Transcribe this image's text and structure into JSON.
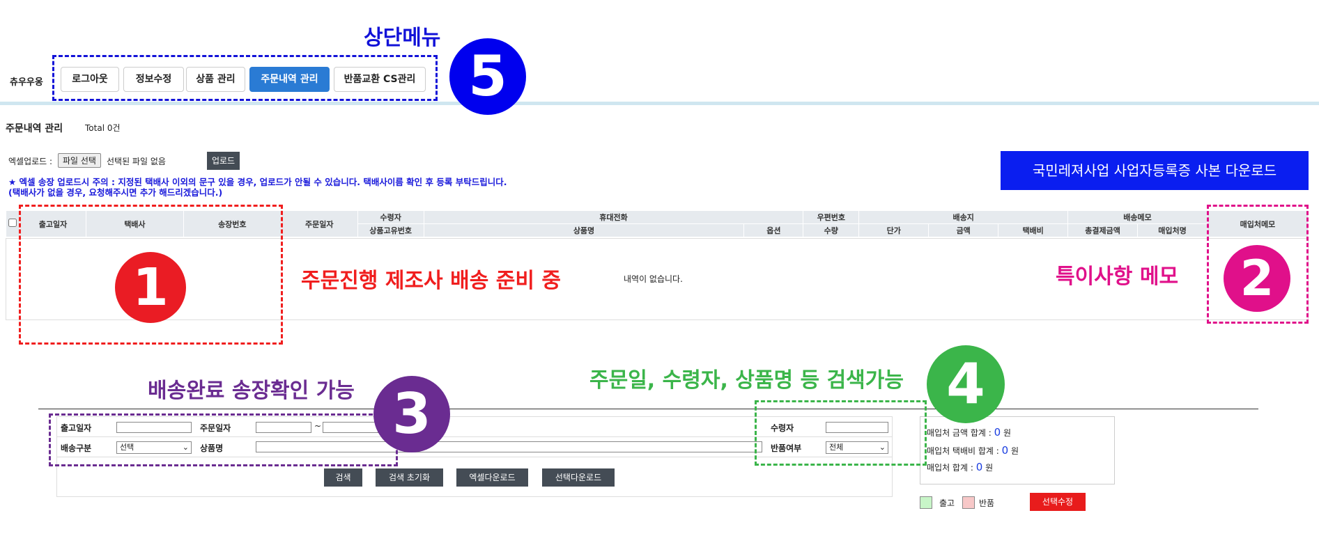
{
  "brand": "츄우우옹",
  "top_menu_annotation": "상단메뉴",
  "top_menu": [
    {
      "label": "로그아웃"
    },
    {
      "label": "정보수정"
    },
    {
      "label": "상품 관리"
    },
    {
      "label": "주문내역 관리",
      "active": true
    },
    {
      "label": "반품교환 CS관리"
    }
  ],
  "page": {
    "title": "주문내역 관리",
    "total": "Total 0건"
  },
  "upload": {
    "label": "엑셀업로드 :",
    "file_button": "파일 선택",
    "file_status": "선택된 파일 없음",
    "upload_button": "업로드"
  },
  "notice": {
    "line1": "★ 엑셀 송장 업로드시 주의 : 지정된 택배사 이외의 문구 있을 경우, 업로드가 안될 수 있습니다. 택배사이름 확인 후 등록 부탁드립니다.",
    "line2": "(택배사가 없을 경우, 요청해주시면 추가 해드리겠습니다.)"
  },
  "download_license_button": "국민레져사업 사업자등록증 사본 다운로드",
  "table": {
    "headers": {
      "ship_date": "출고일자",
      "courier": "택배사",
      "invoice": "송장번호",
      "order_date": "주문일자",
      "recipient": "수령자",
      "phone": "휴대전화",
      "zip": "우편번호",
      "address": "배송지",
      "memo": "배송메모",
      "vendor_memo": "매입처메모",
      "product_id": "상품고유번호",
      "product_name": "상품명",
      "option": "옵션",
      "qty": "수량",
      "unit_price": "단가",
      "amount": "금액",
      "shipping_fee": "택배비",
      "total_paid": "총결제금액",
      "vendor_name": "매입처명"
    },
    "empty_text": "내역이 없습니다."
  },
  "annotations": {
    "a1": "주문진행 제조사 배송 준비 중",
    "a2": "특이사항 메모",
    "a3": "배송완료 송장확인 가능",
    "a4": "주문일, 수령자, 상품명 등 검색가능",
    "n1": "1",
    "n2": "2",
    "n3": "3",
    "n4": "4",
    "n5": "5"
  },
  "search": {
    "ship_date_label": "출고일자",
    "order_date_label": "주문일자",
    "order_date_sep": "~",
    "delivery_type_label": "배송구분",
    "delivery_type_value": "선택",
    "product_name_label": "상품명",
    "recipient_label": "수령자",
    "return_label": "반품여부",
    "return_value": "전체",
    "buttons": {
      "search": "검색",
      "reset": "검색 초기화",
      "excel": "엑셀다운로드",
      "select_download": "선택다운로드"
    }
  },
  "summary": {
    "vendor_amount_label": "매입처 금액 합계 :",
    "vendor_amount": "0",
    "vendor_ship_label": "매입처 택배비 합계 :",
    "vendor_ship": "0",
    "vendor_total_label": "매입처 합계 :",
    "vendor_total": "0",
    "unit": "원"
  },
  "legend": {
    "shipped": "출고",
    "returned": "반품",
    "edit_selected": "선택수정"
  },
  "colors": {
    "accent_blue": "#2a7bd4",
    "annot_red": "#f01e1e",
    "annot_pink": "#e0108a",
    "annot_purple": "#6a2c91",
    "annot_green": "#3bb54a",
    "annot_blue": "#0000ee"
  }
}
